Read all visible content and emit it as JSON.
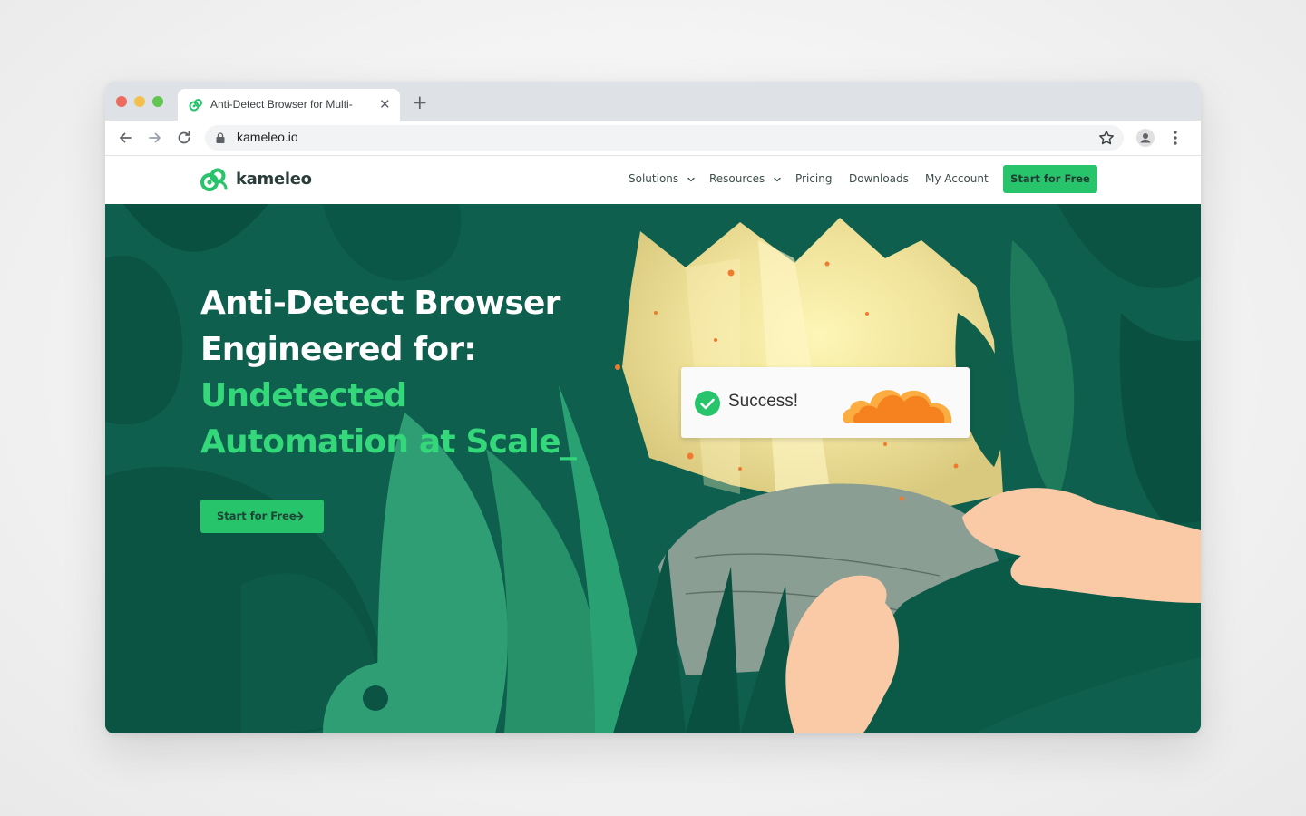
{
  "browser": {
    "tab_title": "Anti-Detect Browser for Multi-",
    "tab_close": "✕",
    "new_tab": "+",
    "url": "kameleo.io"
  },
  "site": {
    "brand": "kameleo",
    "nav": [
      {
        "label": "Solutions",
        "dropdown": true
      },
      {
        "label": "Resources",
        "dropdown": true
      },
      {
        "label": "Pricing",
        "dropdown": false
      },
      {
        "label": "Downloads",
        "dropdown": false
      },
      {
        "label": "My Account",
        "dropdown": false
      }
    ],
    "nav_cta": "Start for Free"
  },
  "hero": {
    "headline_line1": "Anti-Detect Browser",
    "headline_line2": "Engineered for:",
    "highlight_line1": "Undetected",
    "highlight_line2": "Automation at Scale_",
    "cta": "Start for Free",
    "success_text": "Success!"
  },
  "colors": {
    "brand_green": "#27c46b",
    "highlight_green": "#34d77a",
    "hero_bg": "#0d5c4b",
    "cloud_orange": "#f6821f"
  }
}
